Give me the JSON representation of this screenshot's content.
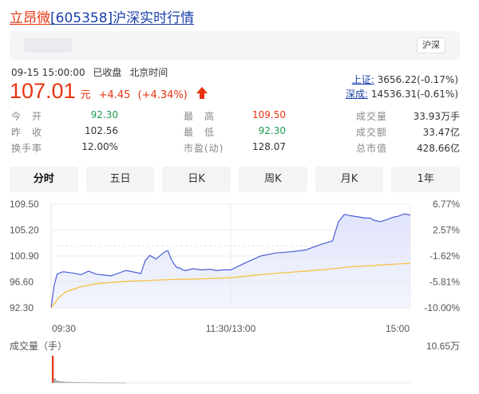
{
  "header": {
    "stock_name": "立昂微",
    "stock_code": "[605358]",
    "title_suffix": "沪深实时行情"
  },
  "search": {
    "market_chip": "沪深"
  },
  "quote": {
    "datetime": "09-15 15:00:00",
    "status": "已收盘",
    "timezone": "北京时间",
    "price": "107.01",
    "unit": "元",
    "change": "+4.45",
    "change_pct": "(+4.34%)"
  },
  "indices": [
    {
      "name": "上证:",
      "value": "3656.22(-0.17%)"
    },
    {
      "name": "深成:",
      "value": "14536.31(-0.61%)"
    }
  ],
  "stats": {
    "open_label": "今　开",
    "open": "92.30",
    "high_label": "最　高",
    "high": "109.50",
    "volume_label": "成交量",
    "volume": "33.93万手",
    "prev_close_label": "昨　收",
    "prev_close": "102.56",
    "low_label": "最　低",
    "low": "92.30",
    "turnover_amt_label": "成交额",
    "turnover_amt": "33.47亿",
    "turnover_rate_label": "换手率",
    "turnover_rate": "12.00%",
    "pe_label": "市盈(动)",
    "pe": "128.07",
    "mkt_cap_label": "总市值",
    "mkt_cap": "428.66亿"
  },
  "tabs": [
    {
      "label": "分时",
      "active": true
    },
    {
      "label": "五日",
      "active": false
    },
    {
      "label": "日K",
      "active": false
    },
    {
      "label": "周K",
      "active": false
    },
    {
      "label": "月K",
      "active": false
    },
    {
      "label": "1年",
      "active": false
    }
  ],
  "colors": {
    "accent_red": "#e8330f",
    "accent_green": "#1e9a4c",
    "link_blue": "#1a3fa8",
    "price_line": "#4a5fd4",
    "avg_line": "#f5c242",
    "area_fill": "#dfe3fa"
  },
  "chart_data": {
    "type": "line",
    "title": "",
    "x_ticks": [
      "09:30",
      "11:30/13:00",
      "15:00"
    ],
    "ylim": [
      92.3,
      109.5
    ],
    "y_ticks_left": [
      "109.50",
      "105.20",
      "100.90",
      "96.60",
      "92.30"
    ],
    "y_ticks_right": [
      "6.77%",
      "2.57%",
      "-1.62%",
      "-5.81%",
      "-10.00%"
    ],
    "prev_close": 102.56,
    "grid": true,
    "series": [
      {
        "kind": "price",
        "x": [
          0,
          2,
          4,
          8,
          14,
          20,
          25,
          30,
          40,
          50,
          60,
          63,
          66,
          70,
          74,
          76,
          78,
          80,
          82,
          84,
          86,
          88,
          90,
          95,
          100,
          106,
          110,
          115,
          120,
          130,
          140,
          150,
          160,
          170,
          180,
          188,
          192,
          196,
          200,
          205,
          210,
          213,
          216,
          220,
          224,
          228,
          232,
          236,
          240
        ],
        "y": [
          92.3,
          96.0,
          97.9,
          98.3,
          98.1,
          97.8,
          98.4,
          97.9,
          97.6,
          98.5,
          98.0,
          100.2,
          101.0,
          100.4,
          101.2,
          101.6,
          101.8,
          100.5,
          99.6,
          99.0,
          98.9,
          98.6,
          98.5,
          98.8,
          98.6,
          98.7,
          98.5,
          98.6,
          98.6,
          99.8,
          100.9,
          101.4,
          101.6,
          101.9,
          102.8,
          103.4,
          106.6,
          107.8,
          107.6,
          107.4,
          107.2,
          107.2,
          106.8,
          106.6,
          106.9,
          107.3,
          107.5,
          107.9,
          107.7
        ]
      },
      {
        "kind": "average",
        "x": [
          0,
          5,
          10,
          20,
          30,
          40,
          50,
          60,
          80,
          100,
          110,
          120,
          140,
          160,
          180,
          200,
          220,
          240
        ],
        "y": [
          92.3,
          94.0,
          95.0,
          95.8,
          96.3,
          96.5,
          96.7,
          96.8,
          97.0,
          97.1,
          97.2,
          97.3,
          97.8,
          98.2,
          98.6,
          99.1,
          99.4,
          99.7
        ]
      }
    ],
    "volume": {
      "label": "成交量（手）",
      "max_label": "10.65万",
      "max": 106500,
      "values": [
        106500,
        18000,
        9000,
        7000,
        6000,
        5000,
        4500,
        4000,
        3800,
        3500,
        3200,
        3000,
        2800,
        2600,
        2500,
        2400,
        2300,
        2200,
        2100,
        2000,
        1900,
        1800,
        1700,
        1600,
        1500,
        1500,
        1400,
        1400,
        1300,
        1300,
        1200,
        1200,
        1100,
        1100,
        1000,
        1000
      ]
    }
  }
}
